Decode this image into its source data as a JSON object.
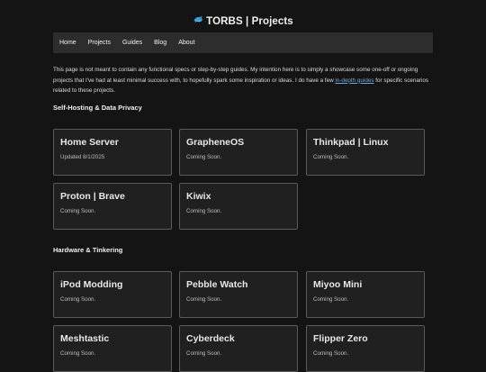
{
  "header": {
    "logo_icon": "dolphin-icon",
    "title": "TORBS | Projects"
  },
  "nav": {
    "items": [
      "Home",
      "Projects",
      "Guides",
      "Blog",
      "About"
    ]
  },
  "intro": {
    "text_before_link": "This page is not meant to contain any functional specs or step-by-step guides. My intention here is to simply a showcase some one-off or ongoing projects that I've had at least minimal success with, to hopefully spark some inspiration or ideas. I do have a few ",
    "link_text": "in-depth guides",
    "text_after_link": " for specific scenarios related to these projects."
  },
  "sections": [
    {
      "title": "Self-Hosting & Data Privacy",
      "cards": [
        {
          "title": "Home Server",
          "subtitle": "Updated 8/1/2025"
        },
        {
          "title": "GrapheneOS",
          "subtitle": "Coming Soon."
        },
        {
          "title": "Thinkpad | Linux",
          "subtitle": "Coming Soon."
        },
        {
          "title": "Proton | Brave",
          "subtitle": "Coming Soon."
        },
        {
          "title": "Kiwix",
          "subtitle": "Coming Soon."
        }
      ]
    },
    {
      "title": "Hardware & Tinkering",
      "cards": [
        {
          "title": "iPod Modding",
          "subtitle": "Coming Soon."
        },
        {
          "title": "Pebble Watch",
          "subtitle": "Coming Soon."
        },
        {
          "title": "Miyoo Mini",
          "subtitle": "Coming Soon."
        },
        {
          "title": "Meshtastic",
          "subtitle": "Coming Soon."
        },
        {
          "title": "Cyberdeck",
          "subtitle": "Coming Soon."
        },
        {
          "title": "Flipper Zero",
          "subtitle": "Coming Soon."
        }
      ]
    }
  ],
  "colors": {
    "background": "#141414",
    "nav_background": "#2d2d2d",
    "card_background": "#202020",
    "card_border": "#5a5a5a",
    "link": "#6fa8dc"
  }
}
